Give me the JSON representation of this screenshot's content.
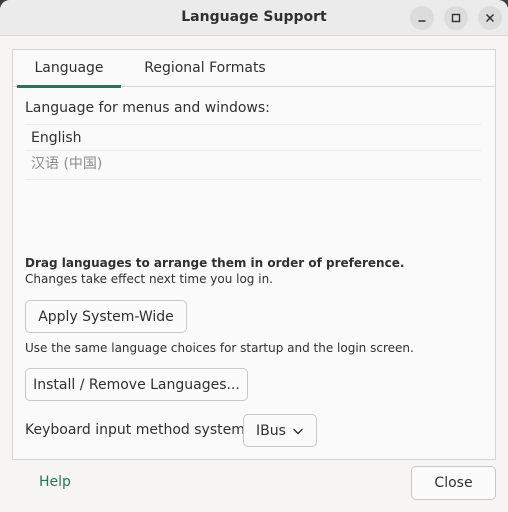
{
  "window": {
    "title": "Language Support"
  },
  "tabs": [
    {
      "label": "Language"
    },
    {
      "label": "Regional Formats"
    }
  ],
  "language": {
    "list_label": "Language for menus and windows:",
    "items": [
      {
        "label": "English"
      },
      {
        "label": "汉语 (中国)"
      }
    ],
    "drag_note": "Drag languages to arrange them in order of preference.",
    "changes_note": "Changes take effect next time you log in.",
    "apply_button": "Apply System-Wide",
    "use_note": "Use the same language choices for startup and the login screen.",
    "install_button": "Install / Remove Languages...",
    "keyboard_label": "Keyboard input method system:",
    "keyboard_value": "IBus"
  },
  "footer": {
    "help_label": "Help",
    "close_label": "Close"
  },
  "colors": {
    "accent": "#1c7a5a"
  },
  "icons": {
    "minimize": "minimize-icon",
    "maximize": "maximize-icon",
    "close": "close-icon",
    "dropdown": "chevron-down-icon"
  }
}
